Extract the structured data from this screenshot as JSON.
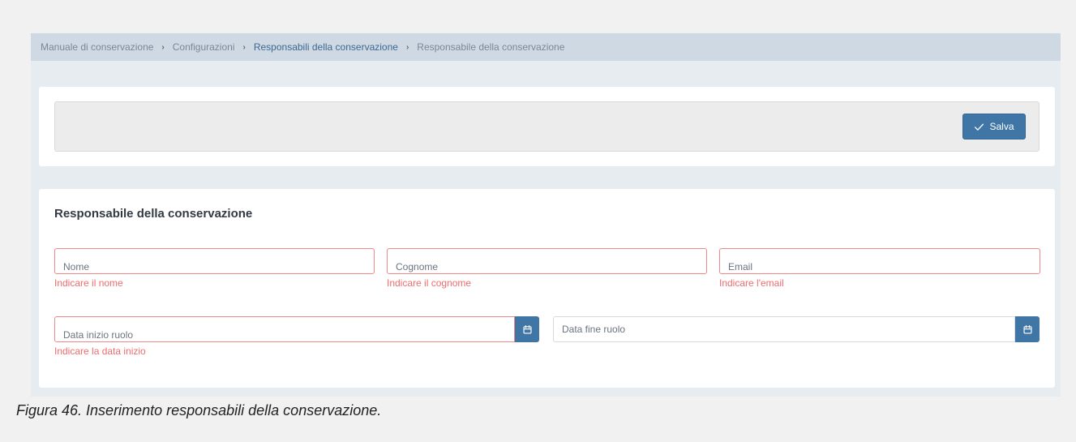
{
  "breadcrumb": {
    "items": [
      {
        "label": "Manuale di conservazione"
      },
      {
        "label": "Configurazioni"
      },
      {
        "label": "Responsabili della conservazione"
      },
      {
        "label": "Responsabile della conservazione"
      }
    ],
    "separator": "›"
  },
  "toolbar": {
    "save_label": "Salva",
    "save_icon": "check-icon"
  },
  "form": {
    "title": "Responsabile della conservazione",
    "fields": {
      "nome": {
        "label": "Nome",
        "error": "Indicare il nome"
      },
      "cognome": {
        "label": "Cognome",
        "error": "Indicare il cognome"
      },
      "email": {
        "label": "Email",
        "error": "Indicare l'email"
      },
      "data_inizio": {
        "label": "Data inizio ruolo",
        "error": "Indicare la data inizio",
        "icon": "calendar-icon"
      },
      "data_fine": {
        "label": "Data fine ruolo",
        "icon": "calendar-icon"
      }
    }
  },
  "caption": "Figura 46. Inserimento responsabili della conservazione.",
  "colors": {
    "accent": "#3f76a6",
    "error": "#ee6c6c",
    "breadcrumb_bg": "#cfd9e3"
  }
}
